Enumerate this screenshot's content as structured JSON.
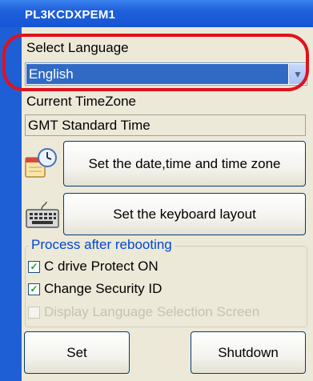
{
  "window": {
    "title": "PL3KCDXPEM1"
  },
  "language": {
    "label": "Select Language",
    "selected": "English"
  },
  "timezone": {
    "label": "Current TimeZone",
    "value": "GMT Standard Time"
  },
  "buttons": {
    "datetime": "Set the date,time and time zone",
    "keyboard": "Set the keyboard layout",
    "set": "Set",
    "shutdown": "Shutdown"
  },
  "reboot_group": {
    "legend": "Process after rebooting",
    "options": [
      {
        "label": "C drive Protect ON",
        "checked": true,
        "enabled": true
      },
      {
        "label": "Change Security ID",
        "checked": true,
        "enabled": true
      },
      {
        "label": "Display Language Selection Screen",
        "checked": false,
        "enabled": false
      }
    ]
  },
  "colors": {
    "accent": "#316ac5",
    "highlight_ring": "#e0121c",
    "group_legend": "#0046d5"
  },
  "icons": {
    "datetime": "clock-calendar-icon",
    "keyboard": "keyboard-icon",
    "dropdown": "chevron-down-icon"
  }
}
